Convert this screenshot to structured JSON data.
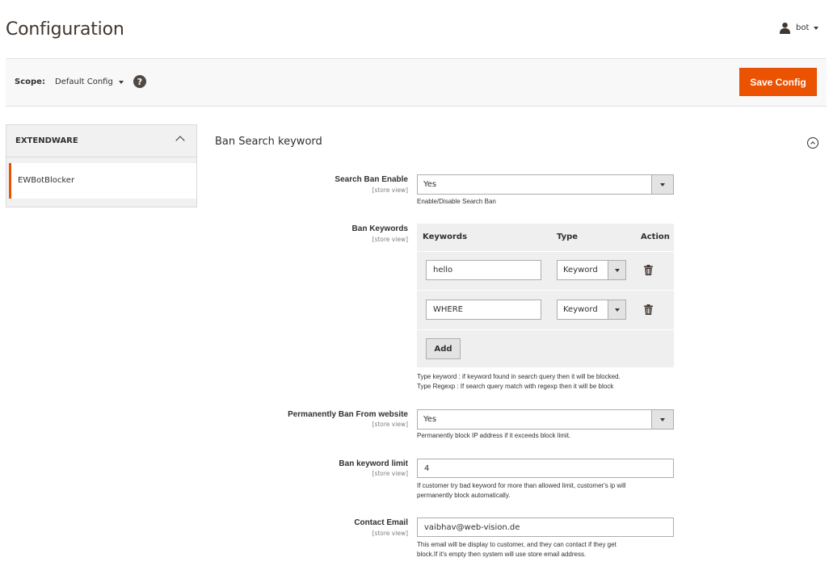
{
  "header": {
    "title": "Configuration",
    "user_name": "bot"
  },
  "scope": {
    "label": "Scope:",
    "value": "Default Config",
    "help_glyph": "?",
    "save_label": "Save Config"
  },
  "sidebar": {
    "section_title": "EXTENDWARE",
    "items": [
      {
        "label": "EWBotBlocker",
        "active": true
      }
    ]
  },
  "section": {
    "title": "Ban Search keyword"
  },
  "fields": {
    "search_ban_enable": {
      "label": "Search Ban Enable",
      "scope": "[store view]",
      "value": "Yes",
      "note": "Enable/Disable Search Ban"
    },
    "ban_keywords": {
      "label": "Ban Keywords",
      "scope": "[store view]",
      "columns": {
        "keywords": "Keywords",
        "type": "Type",
        "action": "Action"
      },
      "rows": [
        {
          "keyword": "hello",
          "type": "Keyword"
        },
        {
          "keyword": "WHERE",
          "type": "Keyword"
        }
      ],
      "add_label": "Add",
      "note_line1": "Type keyword : if keyword found in search query then it will be blocked.",
      "note_line2": "Type Regexp : If search query match with regexp then it will be block"
    },
    "permanently_ban": {
      "label": "Permanently Ban From website",
      "scope": "[store view]",
      "value": "Yes",
      "note": "Permanently block IP address if it exceeds block limit."
    },
    "ban_keyword_limit": {
      "label": "Ban keyword limit",
      "scope": "[store view]",
      "value": "4",
      "note_line1": "If customer try bad keyword for more than allowed limit, customer's ip will",
      "note_line2": "permanently block automatically."
    },
    "contact_email": {
      "label": "Contact Email",
      "scope": "[store view]",
      "value": "vaibhav@web-vision.de",
      "note_line1": "This email will be display to customer, and they can contact if they get",
      "note_line2": "block.If it's empty then system will use store email address."
    }
  },
  "colors": {
    "accent": "#eb5202",
    "text": "#303030",
    "bar_bg": "#f8f8f8"
  },
  "icons": [
    "user-icon",
    "caret-down-icon",
    "help-icon",
    "chevron-up-icon",
    "collapse-circle-icon",
    "trash-icon"
  ]
}
